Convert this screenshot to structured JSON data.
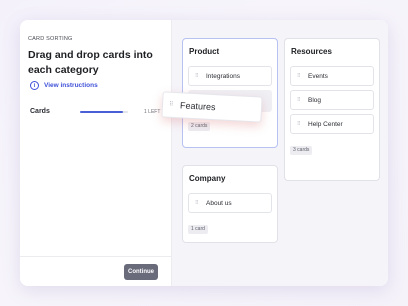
{
  "left_panel": {
    "eyebrow": "CARD SORTING",
    "heading": "Drag and drop cards into each category",
    "instructions_link": "View instructions",
    "cards_label": "Cards",
    "progress_fraction": 0.9,
    "left_count": "1 LEFT",
    "continue_label": "Continue"
  },
  "categories": [
    {
      "title": "Product",
      "cards": [
        "Integrations"
      ],
      "count": "2 cards"
    },
    {
      "title": "Company",
      "cards": [
        "About us"
      ],
      "count": "1 card"
    },
    {
      "title": "Resources",
      "cards": [
        "Events",
        "Blog",
        "Help Center"
      ],
      "count": "3 cards"
    }
  ],
  "dragging_card": "Features",
  "colors": {
    "accent": "#3f51d8",
    "active_border": "#b7c2f2",
    "button": "#696b7b"
  }
}
